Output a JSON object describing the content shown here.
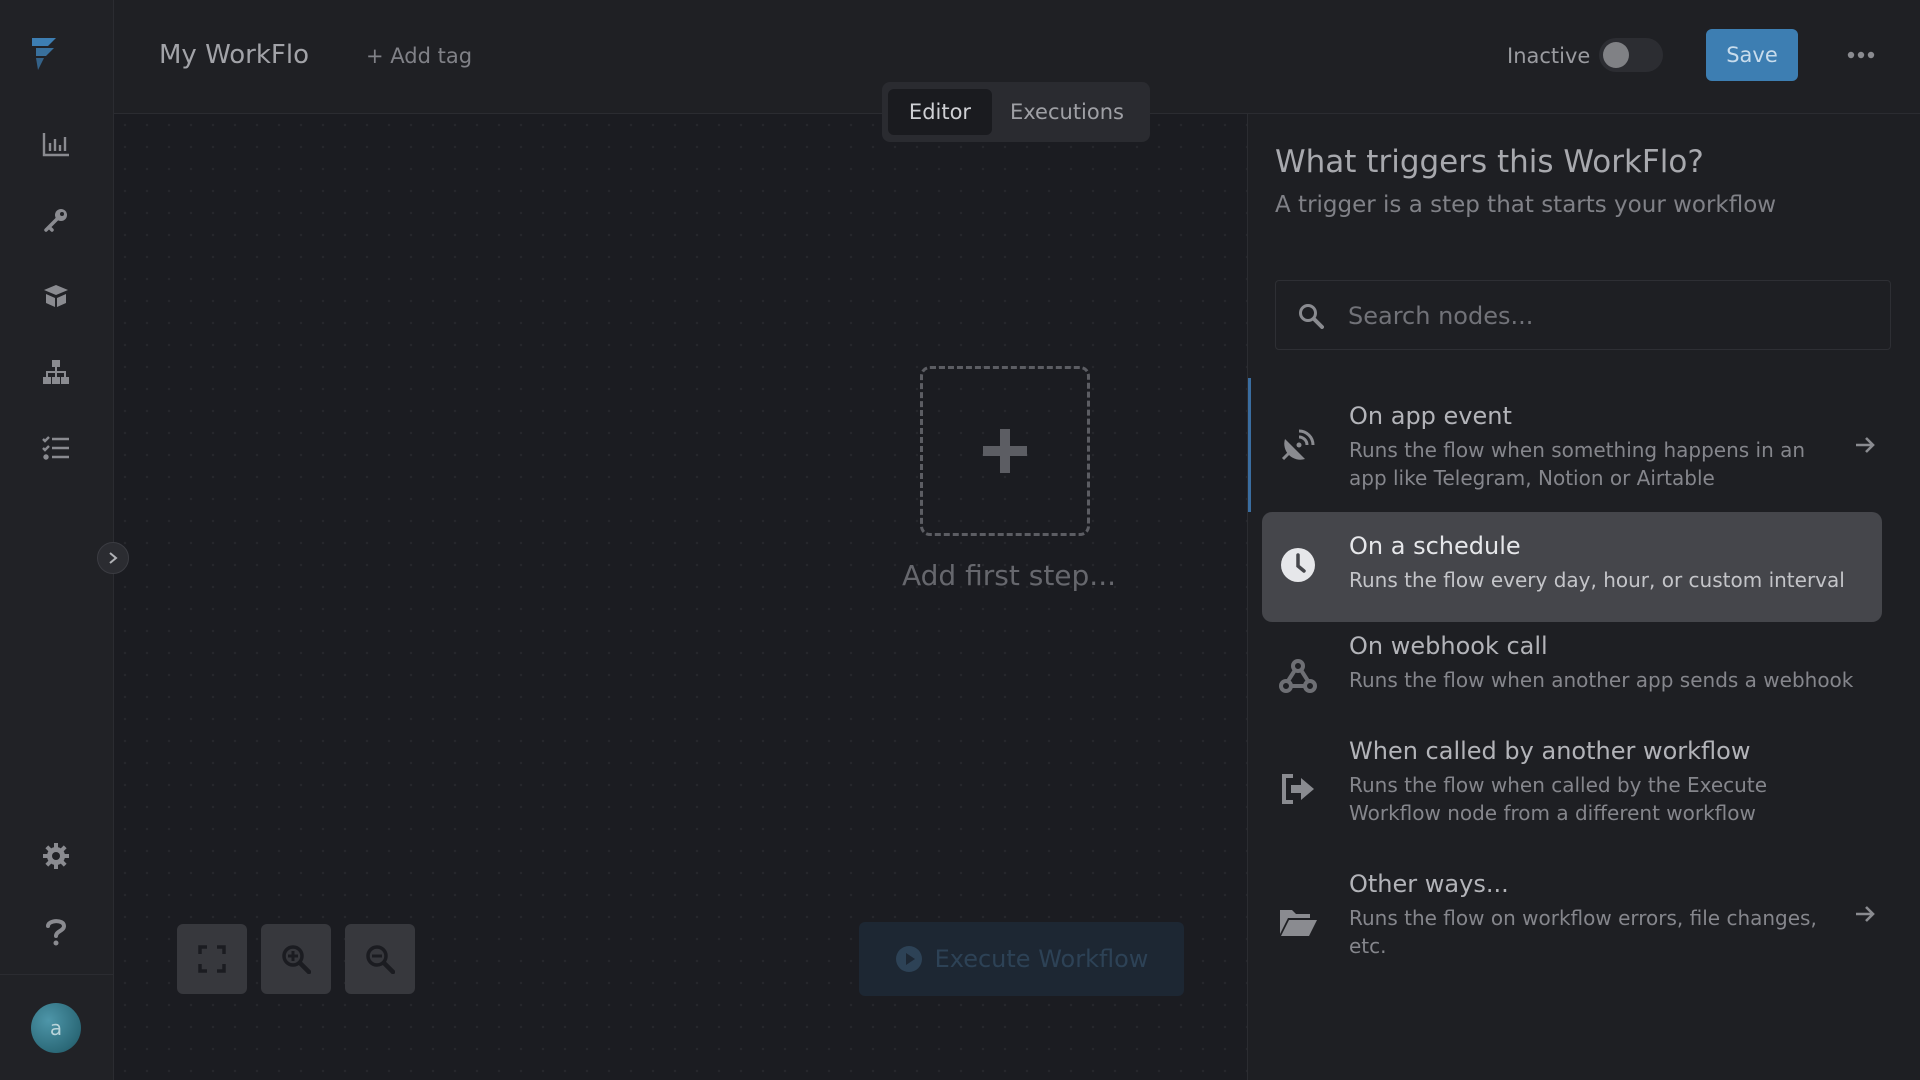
{
  "header": {
    "workflow_name": "My WorkFlo",
    "add_tag": "+ Add tag",
    "status_label": "Inactive",
    "active": false,
    "save_label": "Save"
  },
  "tabs": [
    {
      "label": "Editor",
      "active": true
    },
    {
      "label": "Executions",
      "active": false
    }
  ],
  "sidebar": {
    "items": [
      {
        "icon": "bar-chart-icon"
      },
      {
        "icon": "key-icon"
      },
      {
        "icon": "box-icon"
      },
      {
        "icon": "network-icon"
      },
      {
        "icon": "list-icon"
      }
    ],
    "bottom_items": [
      {
        "icon": "gear-icon"
      },
      {
        "icon": "help-icon"
      }
    ],
    "avatar_initial": "a"
  },
  "canvas": {
    "add_step_label": "Add first step...",
    "execute_label": "Execute Workflow",
    "controls": [
      "fit-view-icon",
      "zoom-in-icon",
      "zoom-out-icon"
    ]
  },
  "panel": {
    "title": "What triggers this WorkFlo?",
    "subtitle": "A trigger is a step that starts your workflow",
    "search_placeholder": "Search nodes...",
    "items": [
      {
        "icon": "satellite-dish-icon",
        "title": "On app event",
        "description": "Runs the flow when something happens in an app like Telegram, Notion or Airtable",
        "has_arrow": true,
        "selected": false
      },
      {
        "icon": "clock-icon",
        "title": "On a schedule",
        "description": "Runs the flow every day, hour, or custom interval",
        "has_arrow": false,
        "selected": true
      },
      {
        "icon": "webhook-icon",
        "title": "On webhook call",
        "description": "Runs the flow when another app sends a webhook",
        "has_arrow": false,
        "selected": false
      },
      {
        "icon": "sign-out-icon",
        "title": "When called by another workflow",
        "description": "Runs the flow when called by the Execute Workflow node from a different workflow",
        "has_arrow": false,
        "selected": false
      },
      {
        "icon": "folder-open-icon",
        "title": "Other ways...",
        "description": "Runs the flow on workflow errors, file changes, etc.",
        "has_arrow": true,
        "selected": false
      }
    ]
  },
  "colors": {
    "accent": "#3d7eb2",
    "background": "#1b1c21",
    "selected_item": "#45464b"
  }
}
